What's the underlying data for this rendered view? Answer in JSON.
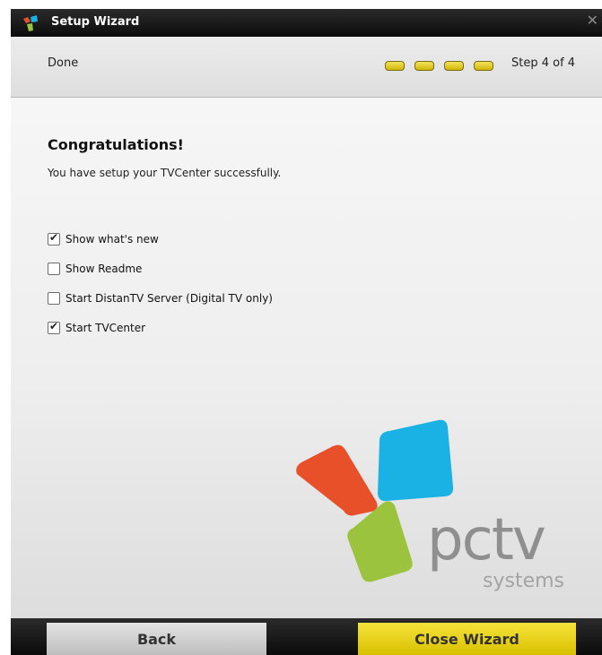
{
  "window": {
    "title": "Setup Wizard",
    "close_glyph": "✕"
  },
  "header": {
    "title": "Done",
    "step_text": "Step 4 of 4",
    "current_step": 4,
    "total_steps": 4,
    "step_color": "#e6cf1e"
  },
  "content": {
    "heading": "Congratulations!",
    "message": "You have setup your TVCenter successfully.",
    "options": [
      {
        "label": "Show what's new",
        "checked": true
      },
      {
        "label": "Show Readme",
        "checked": false
      },
      {
        "label": "Start DistanTV Server (Digital TV only)",
        "checked": false
      },
      {
        "label": "Start TVCenter",
        "checked": true
      }
    ]
  },
  "logo": {
    "word": "pctv",
    "tagline": "systems",
    "colors": {
      "red": "#e8502a",
      "blue": "#1ab2e5",
      "green": "#9bc33d",
      "text": "#8f8f8f"
    }
  },
  "footer": {
    "back_label": "Back",
    "close_label": "Close Wizard"
  }
}
